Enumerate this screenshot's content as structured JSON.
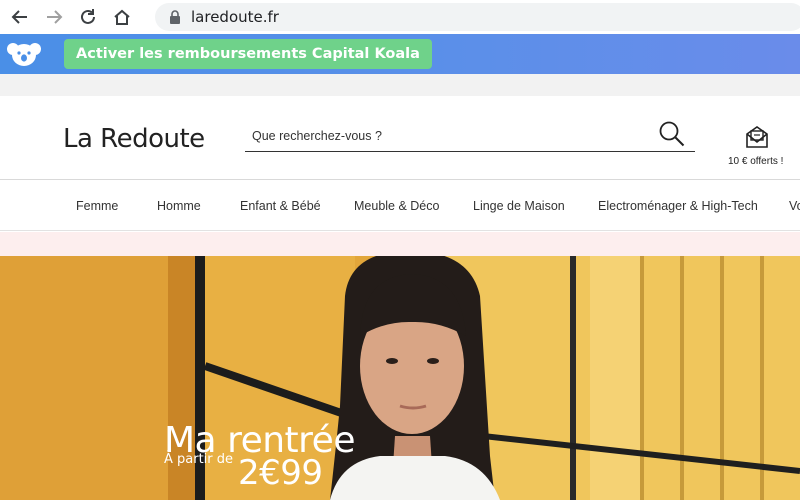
{
  "browser": {
    "url": "laredoute.fr",
    "icons": [
      "back-arrow-icon",
      "forward-arrow-icon",
      "reload-icon",
      "home-icon",
      "lock-icon"
    ]
  },
  "extension": {
    "button_label": "Activer les remboursements Capital Koala",
    "icon": "koala-icon",
    "colors": {
      "bar": "#5a8fe8",
      "button": "#6fd28a"
    }
  },
  "header": {
    "logo": "La Redoute",
    "search_placeholder": "Que recherchez-vous ?",
    "offer_text": "10 € offerts !",
    "icons": [
      "search-icon",
      "gift-icon"
    ]
  },
  "nav": {
    "items": [
      "Femme",
      "Homme",
      "Enfant & Bébé",
      "Meuble & Déco",
      "Linge de Maison",
      "Electroménager & High-Tech",
      "Vo"
    ]
  },
  "hero": {
    "title": "Ma rentrée",
    "from_label": "À partir de",
    "price": "2€99"
  }
}
